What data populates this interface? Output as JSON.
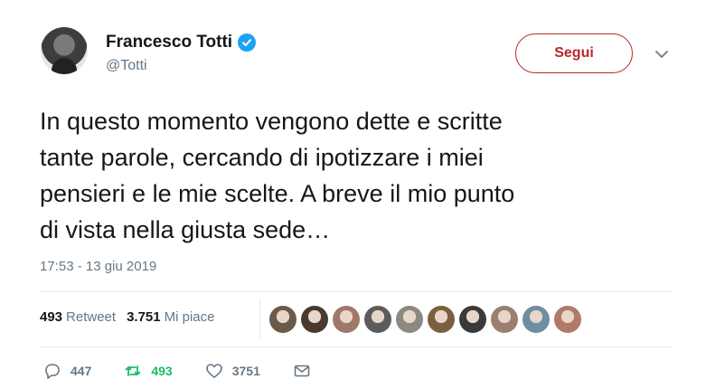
{
  "author": {
    "display_name": "Francesco Totti",
    "handle": "@Totti"
  },
  "follow_button": {
    "label": "Segui"
  },
  "tweet": {
    "text_lines": [
      "In questo momento vengono dette e scritte",
      "tante parole, cercando di ipotizzare i miei",
      "pensieri e le mie scelte. A breve il mio punto",
      "di vista nella giusta sede…"
    ],
    "timestamp": "17:53 - 13 giu 2019"
  },
  "stats": {
    "retweets_count": "493",
    "retweets_label": "Retweet",
    "likes_count": "3.751",
    "likes_label": "Mi piace"
  },
  "likers": [
    {
      "icon": "avatar-1",
      "color": "#6b5a4a"
    },
    {
      "icon": "avatar-2",
      "color": "#4a3a2e"
    },
    {
      "icon": "avatar-3",
      "color": "#a0786a"
    },
    {
      "icon": "avatar-4",
      "color": "#5c5c5c"
    },
    {
      "icon": "avatar-5",
      "color": "#8a8a80"
    },
    {
      "icon": "avatar-6",
      "color": "#7a6040"
    },
    {
      "icon": "avatar-7",
      "color": "#3a3a3a"
    },
    {
      "icon": "avatar-8",
      "color": "#9a8070"
    },
    {
      "icon": "avatar-9",
      "color": "#6e8fa0"
    },
    {
      "icon": "avatar-10",
      "color": "#b07a68"
    }
  ],
  "actions": {
    "reply_count": "447",
    "retweet_count": "493",
    "like_count": "3751"
  },
  "colors": {
    "accent_follow": "#b4282e",
    "verified": "#1da1f2",
    "retweet_green": "#17bf63",
    "muted": "#657786"
  }
}
